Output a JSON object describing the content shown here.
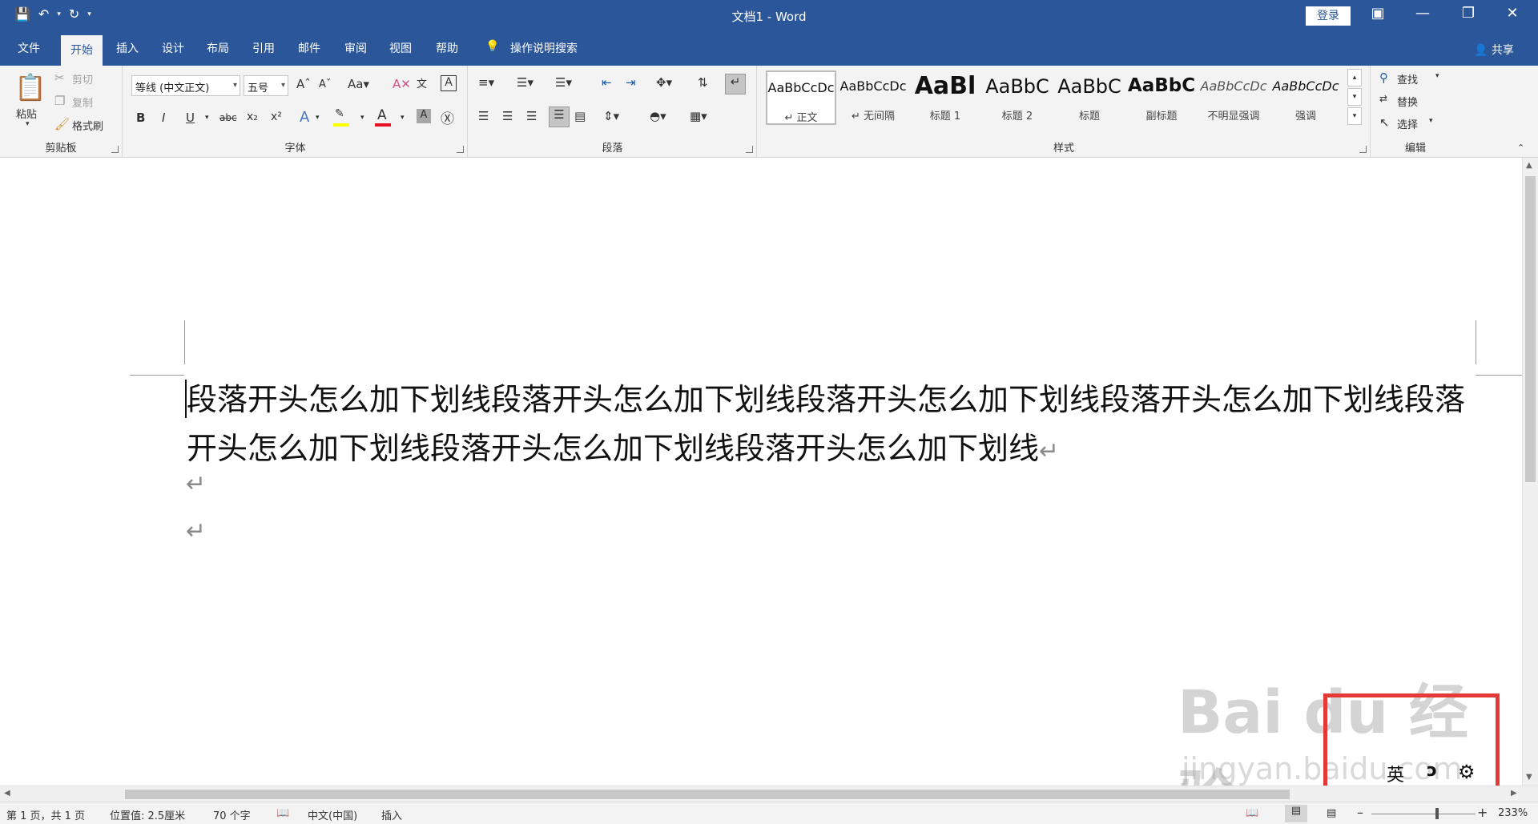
{
  "window": {
    "title": "文档1  -  Word",
    "login_label": "登录"
  },
  "tabs": [
    "文件",
    "开始",
    "插入",
    "设计",
    "布局",
    "引用",
    "邮件",
    "审阅",
    "视图",
    "帮助"
  ],
  "active_tab": "开始",
  "tell_me": "操作说明搜索",
  "share": "共享",
  "clipboard": {
    "paste": "粘贴",
    "cut": "剪切",
    "copy": "复制",
    "format_painter": "格式刷",
    "label": "剪贴板"
  },
  "font": {
    "name": "等线 (中文正文)",
    "size": "五号",
    "label": "字体",
    "bold": "B",
    "italic": "I",
    "underline": "U",
    "strike": "abc",
    "subscript": "x₂",
    "superscript": "x²"
  },
  "paragraph": {
    "label": "段落"
  },
  "styles": {
    "label": "样式",
    "items": [
      {
        "sample": "AaBbCcDc",
        "name": "↵ 正文"
      },
      {
        "sample": "AaBbCcDc",
        "name": "↵ 无间隔"
      },
      {
        "sample": "AaBl",
        "name": "标题 1"
      },
      {
        "sample": "AaBbC",
        "name": "标题 2"
      },
      {
        "sample": "AaBbC",
        "name": "标题"
      },
      {
        "sample": "AaBbC",
        "name": "副标题"
      },
      {
        "sample": "AaBbCcDc",
        "name": "不明显强调"
      },
      {
        "sample": "AaBbCcDc",
        "name": "强调"
      }
    ]
  },
  "editing": {
    "find": "查找",
    "replace": "替换",
    "select": "选择",
    "label": "编辑"
  },
  "document": {
    "paragraph": "段落开头怎么加下划线段落开头怎么加下划线段落开头怎么加下划线段落开头怎么加下划线段落开头怎么加下划线段落开头怎么加下划线段落开头怎么加下划线",
    "para_mark": "↵"
  },
  "watermark": {
    "line1": "Bai du 经验",
    "line2": "jingyan.baidu.com"
  },
  "ime": {
    "lang": "英",
    "mode": "ↄ",
    "settings_icon": "gear-icon"
  },
  "status": {
    "page": "第 1 页，共 1 页",
    "position": "位置值: 2.5厘米",
    "words": "70 个字",
    "language": "中文(中国)",
    "mode": "插入",
    "zoom": "233%"
  },
  "colors": {
    "brand": "#2b579a",
    "ribbon_bg": "#f3f3f3",
    "highlight_box": "#e53935",
    "font_color_bar": "#e81123",
    "highlight_bar": "#ffff00"
  }
}
